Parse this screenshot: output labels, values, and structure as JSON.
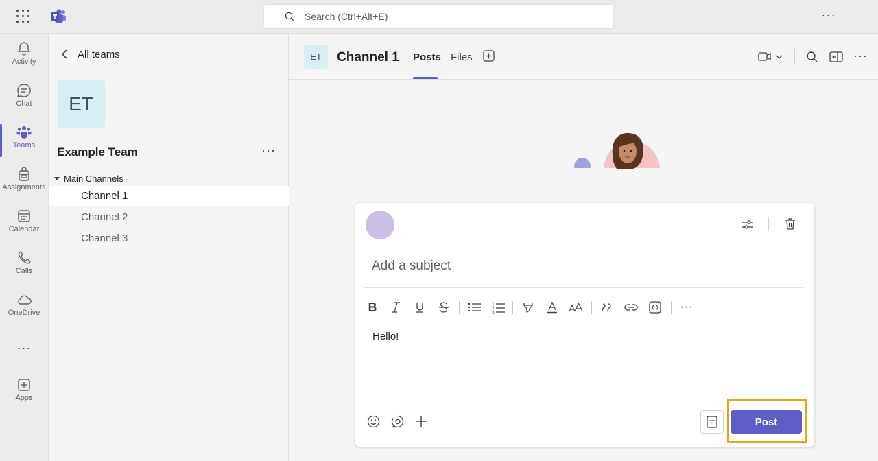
{
  "topbar": {
    "search_placeholder": "Search (Ctrl+Alt+E)",
    "more_label": "···"
  },
  "rail": {
    "items": [
      {
        "label": "Activity",
        "icon": "bell-icon"
      },
      {
        "label": "Chat",
        "icon": "chat-icon"
      },
      {
        "label": "Teams",
        "icon": "teams-icon",
        "active": true
      },
      {
        "label": "Assignments",
        "icon": "backpack-icon"
      },
      {
        "label": "Calendar",
        "icon": "calendar-icon"
      },
      {
        "label": "Calls",
        "icon": "phone-icon"
      },
      {
        "label": "OneDrive",
        "icon": "cloud-icon"
      },
      {
        "label": "Apps",
        "icon": "plus-box-icon"
      }
    ],
    "more_label": "···"
  },
  "teampane": {
    "back_label": "All teams",
    "team_initials": "ET",
    "team_name": "Example Team",
    "more_label": "···",
    "section_label": "Main Channels",
    "channels": [
      "Channel 1",
      "Channel 2",
      "Channel 3"
    ]
  },
  "channel_header": {
    "initials": "ET",
    "title": "Channel 1",
    "tabs": [
      "Posts",
      "Files"
    ],
    "more_label": "···"
  },
  "compose": {
    "subject_placeholder": "Add a subject",
    "body_text": "Hello!",
    "post_label": "Post",
    "more_format_label": "···"
  },
  "colors": {
    "accent": "#5b5fc7",
    "highlight": "#f0a30a"
  }
}
